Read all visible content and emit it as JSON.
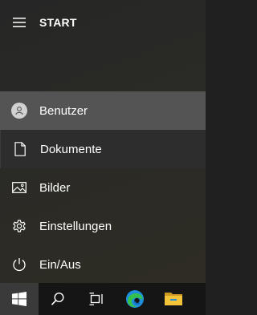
{
  "header": {
    "title": "START",
    "menu_icon": "hamburger-icon"
  },
  "items": [
    {
      "label": "Benutzer",
      "icon": "user-avatar-icon"
    },
    {
      "label": "Dokumente",
      "icon": "document-icon"
    },
    {
      "label": "Bilder",
      "icon": "pictures-icon"
    },
    {
      "label": "Einstellungen",
      "icon": "gear-icon"
    },
    {
      "label": "Ein/Aus",
      "icon": "power-icon"
    }
  ],
  "taskbar": {
    "buttons": [
      "windows-start-icon",
      "search-icon",
      "task-view-icon",
      "edge-icon",
      "file-explorer-icon"
    ]
  },
  "colors": {
    "selected_item": "#545454",
    "taskbar": "#151515",
    "edge_blue": "#1f8fdc",
    "edge_green": "#35c24a",
    "folder_yellow": "#f3c43a"
  }
}
